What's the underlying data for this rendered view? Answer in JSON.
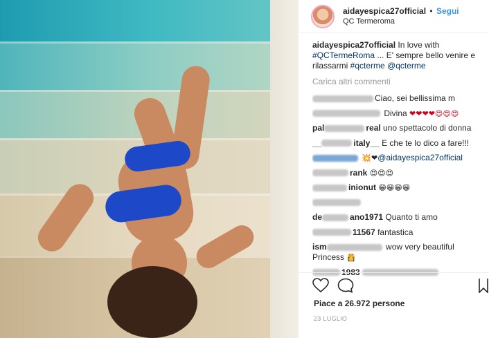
{
  "post": {
    "username": "aidayespica27official",
    "separator": "•",
    "follow_label": "Segui",
    "location": "QC Termeroma"
  },
  "caption": {
    "username": "aidayespica27official",
    "text1": "In love with",
    "hashtag1": "#QCTermeRoma",
    "text2": " ... E' sempre bello venire e rilassarmi ",
    "hashtag2": "#qcterme",
    "mention": "@qcterme"
  },
  "load_more": "Carica altri commenti",
  "comments": [
    {
      "user_tail": "",
      "text": "Ciao, sei bellissima m"
    },
    {
      "user_tail": "",
      "text": "Divina",
      "emoji": "❤❤❤❤😍😍😍"
    },
    {
      "user_tail": "pal",
      "user_end": "real",
      "text": "uno spettacolo di donna"
    },
    {
      "user_tail": "__",
      "user_end": "italy__",
      "text": "E che te lo dico a fare!!!"
    },
    {
      "user_tail": "",
      "emoji": "💥❤",
      "mention": "@aidayespica27official"
    },
    {
      "user_tail": "",
      "user_end": "rank",
      "emoji": "😍😍😍"
    },
    {
      "user_tail": "",
      "user_end": "inionut",
      "emoji": "😁😁😁😁"
    },
    {
      "user_tail": "",
      "text": ""
    },
    {
      "user_tail": "de",
      "user_end": "ano1971",
      "text": "Quanto ti amo"
    },
    {
      "user_tail": "",
      "user_end": "11567",
      "text": "fantastica"
    },
    {
      "user_tail": "ism",
      "user_end": "",
      "text": "wow very beautiful Princess",
      "emoji": "👸"
    },
    {
      "user_tail": "",
      "user_end": "1983",
      "text": ""
    }
  ],
  "likes_text": "Piace a 26.972 persone",
  "date": "23 LUGLIO",
  "icons": {
    "like": "heart-icon",
    "comment": "comment-icon",
    "save": "bookmark-icon"
  },
  "colors": {
    "link": "#003569",
    "follow": "#3897f0",
    "muted": "#999999"
  }
}
